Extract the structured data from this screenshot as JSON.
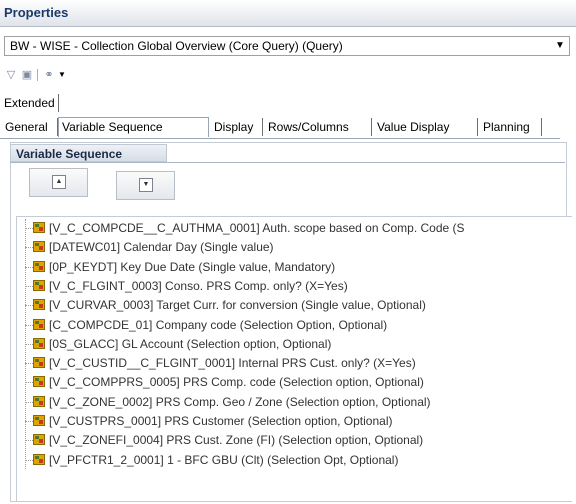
{
  "window": {
    "title": "Properties"
  },
  "query_select": {
    "value": "BW - WISE - Collection Global Overview (Core Query) (Query)"
  },
  "toolbar": {
    "icons": [
      "filter-icon",
      "save-icon",
      "link-icon",
      "dropdown-arrow-icon"
    ]
  },
  "tabs_row1": [
    {
      "label": "Extended"
    }
  ],
  "tabs_row2": [
    {
      "label": "General",
      "active": false
    },
    {
      "label": "Variable Sequence",
      "active": true
    },
    {
      "label": "Display",
      "active": false
    },
    {
      "label": "Rows/Columns",
      "active": false
    },
    {
      "label": "Value Display",
      "active": false
    },
    {
      "label": "Planning",
      "active": false
    }
  ],
  "panel": {
    "title": "Variable Sequence"
  },
  "variables": [
    "[V_C_COMPCDE__C_AUTHMA_0001] Auth. scope based on Comp. Code (S",
    "[DATEWC01] Calendar Day (Single value)",
    "[0P_KEYDT] Key Due Date (Single value, Mandatory)",
    "[V_C_FLGINT_0003] Conso. PRS Comp. only? (X=Yes)",
    "[V_CURVAR_0003] Target Curr. for conversion (Single value, Optional)",
    "[C_COMPCDE_01] Company code (Selection Option, Optional)",
    "[0S_GLACC] GL Account (Selection option, Optional)",
    "[V_C_CUSTID__C_FLGINT_0001] Internal PRS Cust. only? (X=Yes)",
    "[V_C_COMPPRS_0005] PRS Comp. code (Selection option, Optional)",
    "[V_C_ZONE_0002] PRS Comp. Geo / Zone (Selection option, Optional)",
    "[V_CUSTPRS_0001] PRS Customer (Selection option, Optional)",
    "[V_C_ZONEFI_0004] PRS Cust. Zone (FI) (Selection option, Optional)",
    "[V_PFCTR1_2_0001] 1 - BFC GBU (Clt) (Selection Opt, Optional)"
  ],
  "colors": {
    "accent": "#1b3a6b",
    "variable_icon": "#e0a400"
  }
}
